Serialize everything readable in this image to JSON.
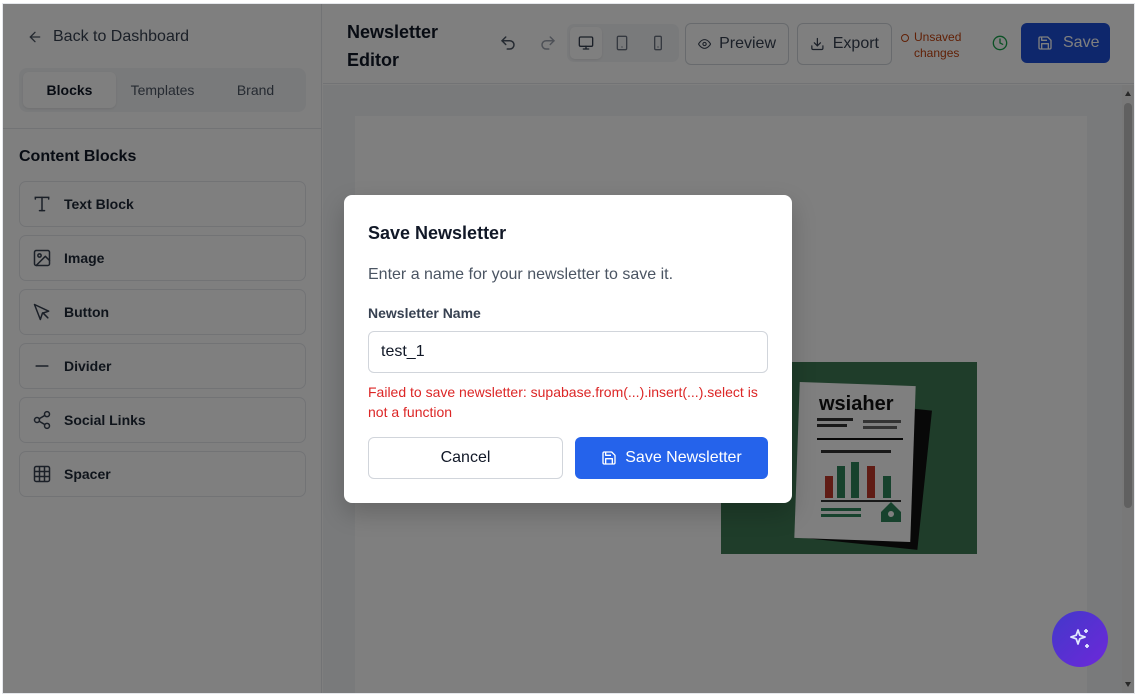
{
  "sidebar": {
    "back_label": "Back to Dashboard",
    "tabs": [
      {
        "label": "Blocks",
        "active": true
      },
      {
        "label": "Templates",
        "active": false
      },
      {
        "label": "Brand",
        "active": false
      }
    ],
    "section_title": "Content Blocks",
    "blocks": [
      {
        "label": "Text Block",
        "icon": "text-icon"
      },
      {
        "label": "Image",
        "icon": "image-icon"
      },
      {
        "label": "Button",
        "icon": "pointer-icon"
      },
      {
        "label": "Divider",
        "icon": "minus-icon"
      },
      {
        "label": "Social Links",
        "icon": "share-icon"
      },
      {
        "label": "Spacer",
        "icon": "grid-icon"
      }
    ]
  },
  "header": {
    "title": "Newsletter Editor",
    "preview_label": "Preview",
    "export_label": "Export",
    "unsaved_label": "Unsaved changes",
    "save_label": "Save",
    "active_device": "desktop"
  },
  "canvas": {
    "image_text": "wsiaher"
  },
  "modal": {
    "title": "Save Newsletter",
    "description": "Enter a name for your newsletter to save it.",
    "name_label": "Newsletter Name",
    "name_value": "test_1",
    "error": "Failed to save newsletter: supabase.from(...).insert(...).select is not a function",
    "cancel_label": "Cancel",
    "save_label": "Save Newsletter"
  },
  "colors": {
    "primary": "#2563eb",
    "save_dark": "#1d4ed8",
    "error": "#dc2626",
    "unsaved": "#c2410c",
    "clock": "#16a34a"
  }
}
